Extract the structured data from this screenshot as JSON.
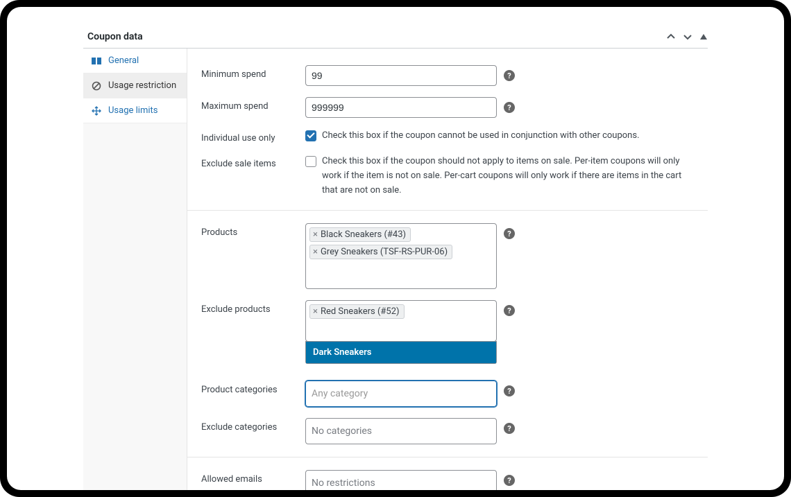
{
  "panel": {
    "title": "Coupon data"
  },
  "sidebar": {
    "tabs": [
      {
        "label": "General",
        "icon": "ticket-icon"
      },
      {
        "label": "Usage restriction",
        "icon": "block-icon"
      },
      {
        "label": "Usage limits",
        "icon": "move-icon"
      }
    ]
  },
  "fields": {
    "min_spend": {
      "label": "Minimum spend",
      "value": "99"
    },
    "max_spend": {
      "label": "Maximum spend",
      "value": "999999"
    },
    "individual_use": {
      "label": "Individual use only",
      "description": "Check this box if the coupon cannot be used in conjunction with other coupons.",
      "checked": true
    },
    "exclude_sale": {
      "label": "Exclude sale items",
      "description": "Check this box if the coupon should not apply to items on sale. Per-item coupons will only work if the item is not on sale. Per-cart coupons will only work if there are items in the cart that are not on sale.",
      "checked": false
    },
    "products": {
      "label": "Products",
      "tags": [
        "Black Sneakers (#43)",
        "Grey Sneakers (TSF-RS-PUR-06)"
      ]
    },
    "exclude_products": {
      "label": "Exclude products",
      "tags": [
        "Red Sneakers (#52)"
      ],
      "dropdown_option": "Dark Sneakers"
    },
    "categories": {
      "label": "Product categories",
      "placeholder": "Any category"
    },
    "exclude_categories": {
      "label": "Exclude categories",
      "placeholder": "No categories"
    },
    "allowed_emails": {
      "label": "Allowed emails",
      "placeholder": "No restrictions"
    }
  }
}
